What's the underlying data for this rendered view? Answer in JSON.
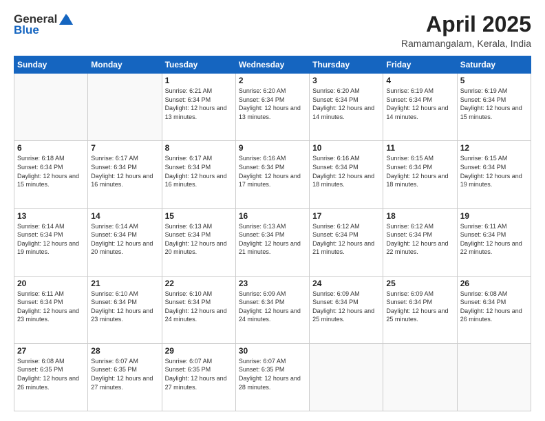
{
  "header": {
    "logo_general": "General",
    "logo_blue": "Blue",
    "title": "April 2025",
    "subtitle": "Ramamangalam, Kerala, India"
  },
  "weekdays": [
    "Sunday",
    "Monday",
    "Tuesday",
    "Wednesday",
    "Thursday",
    "Friday",
    "Saturday"
  ],
  "weeks": [
    [
      {
        "day": null
      },
      {
        "day": null
      },
      {
        "day": "1",
        "sunrise": "Sunrise: 6:21 AM",
        "sunset": "Sunset: 6:34 PM",
        "daylight": "Daylight: 12 hours and 13 minutes."
      },
      {
        "day": "2",
        "sunrise": "Sunrise: 6:20 AM",
        "sunset": "Sunset: 6:34 PM",
        "daylight": "Daylight: 12 hours and 13 minutes."
      },
      {
        "day": "3",
        "sunrise": "Sunrise: 6:20 AM",
        "sunset": "Sunset: 6:34 PM",
        "daylight": "Daylight: 12 hours and 14 minutes."
      },
      {
        "day": "4",
        "sunrise": "Sunrise: 6:19 AM",
        "sunset": "Sunset: 6:34 PM",
        "daylight": "Daylight: 12 hours and 14 minutes."
      },
      {
        "day": "5",
        "sunrise": "Sunrise: 6:19 AM",
        "sunset": "Sunset: 6:34 PM",
        "daylight": "Daylight: 12 hours and 15 minutes."
      }
    ],
    [
      {
        "day": "6",
        "sunrise": "Sunrise: 6:18 AM",
        "sunset": "Sunset: 6:34 PM",
        "daylight": "Daylight: 12 hours and 15 minutes."
      },
      {
        "day": "7",
        "sunrise": "Sunrise: 6:17 AM",
        "sunset": "Sunset: 6:34 PM",
        "daylight": "Daylight: 12 hours and 16 minutes."
      },
      {
        "day": "8",
        "sunrise": "Sunrise: 6:17 AM",
        "sunset": "Sunset: 6:34 PM",
        "daylight": "Daylight: 12 hours and 16 minutes."
      },
      {
        "day": "9",
        "sunrise": "Sunrise: 6:16 AM",
        "sunset": "Sunset: 6:34 PM",
        "daylight": "Daylight: 12 hours and 17 minutes."
      },
      {
        "day": "10",
        "sunrise": "Sunrise: 6:16 AM",
        "sunset": "Sunset: 6:34 PM",
        "daylight": "Daylight: 12 hours and 18 minutes."
      },
      {
        "day": "11",
        "sunrise": "Sunrise: 6:15 AM",
        "sunset": "Sunset: 6:34 PM",
        "daylight": "Daylight: 12 hours and 18 minutes."
      },
      {
        "day": "12",
        "sunrise": "Sunrise: 6:15 AM",
        "sunset": "Sunset: 6:34 PM",
        "daylight": "Daylight: 12 hours and 19 minutes."
      }
    ],
    [
      {
        "day": "13",
        "sunrise": "Sunrise: 6:14 AM",
        "sunset": "Sunset: 6:34 PM",
        "daylight": "Daylight: 12 hours and 19 minutes."
      },
      {
        "day": "14",
        "sunrise": "Sunrise: 6:14 AM",
        "sunset": "Sunset: 6:34 PM",
        "daylight": "Daylight: 12 hours and 20 minutes."
      },
      {
        "day": "15",
        "sunrise": "Sunrise: 6:13 AM",
        "sunset": "Sunset: 6:34 PM",
        "daylight": "Daylight: 12 hours and 20 minutes."
      },
      {
        "day": "16",
        "sunrise": "Sunrise: 6:13 AM",
        "sunset": "Sunset: 6:34 PM",
        "daylight": "Daylight: 12 hours and 21 minutes."
      },
      {
        "day": "17",
        "sunrise": "Sunrise: 6:12 AM",
        "sunset": "Sunset: 6:34 PM",
        "daylight": "Daylight: 12 hours and 21 minutes."
      },
      {
        "day": "18",
        "sunrise": "Sunrise: 6:12 AM",
        "sunset": "Sunset: 6:34 PM",
        "daylight": "Daylight: 12 hours and 22 minutes."
      },
      {
        "day": "19",
        "sunrise": "Sunrise: 6:11 AM",
        "sunset": "Sunset: 6:34 PM",
        "daylight": "Daylight: 12 hours and 22 minutes."
      }
    ],
    [
      {
        "day": "20",
        "sunrise": "Sunrise: 6:11 AM",
        "sunset": "Sunset: 6:34 PM",
        "daylight": "Daylight: 12 hours and 23 minutes."
      },
      {
        "day": "21",
        "sunrise": "Sunrise: 6:10 AM",
        "sunset": "Sunset: 6:34 PM",
        "daylight": "Daylight: 12 hours and 23 minutes."
      },
      {
        "day": "22",
        "sunrise": "Sunrise: 6:10 AM",
        "sunset": "Sunset: 6:34 PM",
        "daylight": "Daylight: 12 hours and 24 minutes."
      },
      {
        "day": "23",
        "sunrise": "Sunrise: 6:09 AM",
        "sunset": "Sunset: 6:34 PM",
        "daylight": "Daylight: 12 hours and 24 minutes."
      },
      {
        "day": "24",
        "sunrise": "Sunrise: 6:09 AM",
        "sunset": "Sunset: 6:34 PM",
        "daylight": "Daylight: 12 hours and 25 minutes."
      },
      {
        "day": "25",
        "sunrise": "Sunrise: 6:09 AM",
        "sunset": "Sunset: 6:34 PM",
        "daylight": "Daylight: 12 hours and 25 minutes."
      },
      {
        "day": "26",
        "sunrise": "Sunrise: 6:08 AM",
        "sunset": "Sunset: 6:34 PM",
        "daylight": "Daylight: 12 hours and 26 minutes."
      }
    ],
    [
      {
        "day": "27",
        "sunrise": "Sunrise: 6:08 AM",
        "sunset": "Sunset: 6:35 PM",
        "daylight": "Daylight: 12 hours and 26 minutes."
      },
      {
        "day": "28",
        "sunrise": "Sunrise: 6:07 AM",
        "sunset": "Sunset: 6:35 PM",
        "daylight": "Daylight: 12 hours and 27 minutes."
      },
      {
        "day": "29",
        "sunrise": "Sunrise: 6:07 AM",
        "sunset": "Sunset: 6:35 PM",
        "daylight": "Daylight: 12 hours and 27 minutes."
      },
      {
        "day": "30",
        "sunrise": "Sunrise: 6:07 AM",
        "sunset": "Sunset: 6:35 PM",
        "daylight": "Daylight: 12 hours and 28 minutes."
      },
      {
        "day": null
      },
      {
        "day": null
      },
      {
        "day": null
      }
    ]
  ]
}
